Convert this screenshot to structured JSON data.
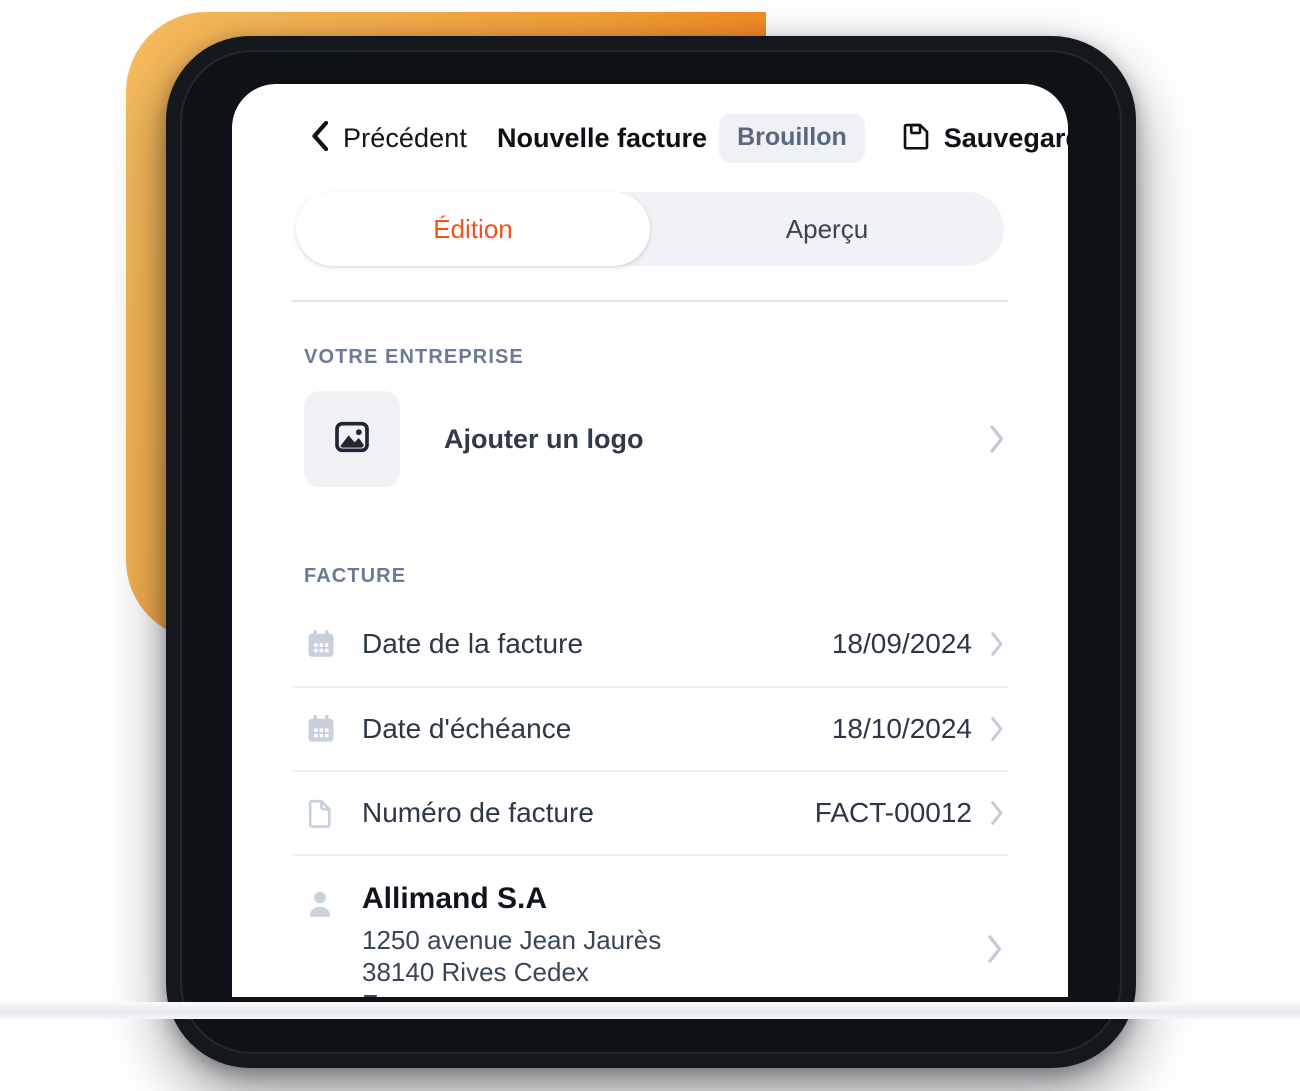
{
  "colors": {
    "accent_orange": "#F4541A",
    "blob_gradient_start": "#F5BC5E",
    "blob_gradient_end": "#F5761A",
    "bezel_dark": "#14181c",
    "section_label": "#697B96",
    "text_primary": "#2C3748",
    "chevron_gray": "#C5CBD4",
    "icon_gray": "#C8D0DC",
    "badge_bg": "#EFF1F5",
    "badge_text": "#5A6780"
  },
  "header": {
    "back_label": "Précédent",
    "back_icon": "chevron-left-icon",
    "title": "Nouvelle facture",
    "status_badge": "Brouillon",
    "save_label": "Sauvegarder",
    "save_icon": "save-floppy-icon"
  },
  "tabs": [
    {
      "label": "Édition",
      "active": true
    },
    {
      "label": "Aperçu",
      "active": false
    }
  ],
  "sections": [
    {
      "title": "VOTRE ENTREPRISE",
      "logo_row": {
        "label": "Ajouter un logo",
        "icon": "image-placeholder-icon",
        "chevron": "chevron-right-icon"
      }
    },
    {
      "title": "FACTURE",
      "rows": [
        {
          "icon": "calendar-icon",
          "label": "Date de la facture",
          "value": "18/09/2024",
          "chevron": "chevron-right-icon"
        },
        {
          "icon": "calendar-icon",
          "label": "Date d'échéance",
          "value": "18/10/2024",
          "chevron": "chevron-right-icon"
        },
        {
          "icon": "document-icon",
          "label": "Numéro de facture",
          "value": "FACT-00012",
          "chevron": "chevron-right-icon"
        }
      ],
      "client": {
        "icon": "person-icon",
        "name": "Allimand S.A",
        "address_line1": "1250 avenue Jean Jaurès",
        "address_line2": "38140 Rives Cedex",
        "address_line3": "France",
        "chevron": "chevron-right-icon"
      }
    }
  ]
}
